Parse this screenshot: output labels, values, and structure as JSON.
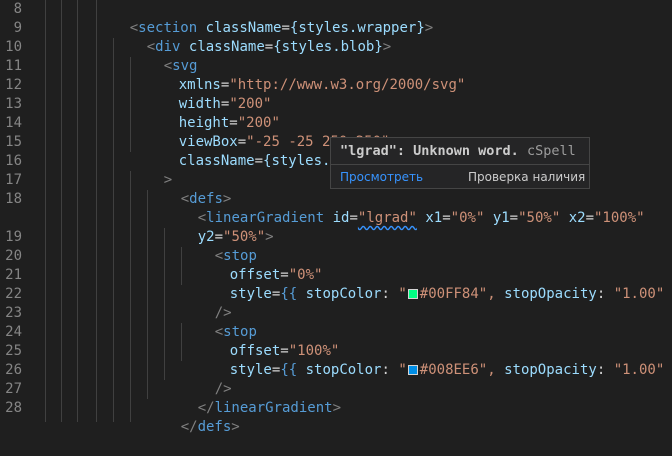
{
  "editor": {
    "line_numbers": [
      "8",
      "9",
      "10",
      "11",
      "12",
      "13",
      "14",
      "15",
      "16",
      "17",
      "18",
      "19",
      "20",
      "21",
      "22",
      "23",
      "24",
      "25",
      "26",
      "27",
      "28"
    ],
    "code": {
      "l8": {
        "open": "<",
        "tag": "section",
        "attr": "className",
        "eq": "=",
        "val": "{styles.wrapper}",
        "close": ">"
      },
      "l9": {
        "open": "<",
        "tag": "div",
        "attr": "className",
        "eq": "=",
        "val": "{styles.blob}",
        "close": ">"
      },
      "l10": {
        "open": "<",
        "tag": "svg"
      },
      "l11": {
        "attr": "xmlns",
        "eq": "=",
        "val": "\"http://www.w3.org/2000/svg\""
      },
      "l12": {
        "attr": "width",
        "eq": "=",
        "val": "\"200\""
      },
      "l13": {
        "attr": "height",
        "eq": "=",
        "val": "\"200\""
      },
      "l14": {
        "attr": "viewBox",
        "eq": "=",
        "val": "\"-25 -25 250 250\""
      },
      "l15": {
        "attr": "className",
        "eq": "=",
        "val": "{styles.floa"
      },
      "l16": {
        "close": ">"
      },
      "l17": {
        "open": "<",
        "tag": "defs",
        "close": ">"
      },
      "l18": {
        "open": "<",
        "tag": "linearGradient",
        "a1": "id",
        "v1": "\"lgrad\"",
        "a2": "x1",
        "v2": "\"0%\"",
        "a3": "y1",
        "v3": "\"50%\"",
        "a4": "x2",
        "v4": "\"100%\""
      },
      "l18b": {
        "attr": "y2",
        "eq": "=",
        "val": "\"50%\"",
        "close": ">"
      },
      "l19": {
        "open": "<",
        "tag": "stop"
      },
      "l20": {
        "attr": "offset",
        "eq": "=",
        "val": "\"0%\""
      },
      "l21": {
        "attr": "style",
        "eq": "=",
        "lb": "{{",
        "k1": "stopColor",
        "c": ":",
        "q": "\"",
        "color": "#00FF84",
        "qe": "\",",
        "k2": "stopOpacity",
        "v2": "\"1.00\"",
        "rb": "}}"
      },
      "l22": {
        "close": "/>"
      },
      "l23": {
        "open": "<",
        "tag": "stop"
      },
      "l24": {
        "attr": "offset",
        "eq": "=",
        "val": "\"100%\""
      },
      "l25": {
        "attr": "style",
        "eq": "=",
        "lb": "{{",
        "k1": "stopColor",
        "c": ":",
        "q": "\"",
        "color": "#008EE6",
        "qe": "\",",
        "k2": "stopOpacity",
        "v2": "\"1.00\"",
        "rb": "}}"
      },
      "l26": {
        "close": "/>"
      },
      "l27": {
        "open": "</",
        "tag": "linearGradient",
        "close": ">"
      },
      "l28": {
        "open": "</",
        "tag": "defs",
        "close": ">"
      }
    },
    "swatch_colors": {
      "green": "#00FF84",
      "blue": "#008EE6"
    }
  },
  "hover": {
    "message": "\"lgrad\": Unknown word.",
    "source": "cSpell",
    "action_peek": "Просмотреть",
    "action_check": "Проверка наличия"
  },
  "colors": {
    "background": "#1f1f1f",
    "tag": "#569cd6",
    "attribute": "#9cdcfe",
    "string": "#ce9178",
    "link": "#3794ff"
  }
}
